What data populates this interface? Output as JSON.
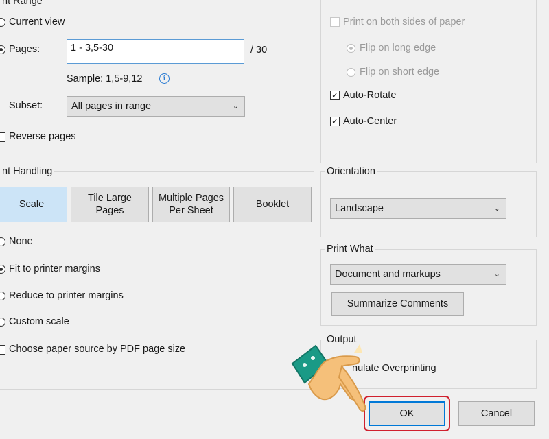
{
  "page_range": {
    "legend": "nt Range",
    "current_view": "Current view",
    "pages_label": "Pages:",
    "pages_value": "1 - 3,5-30",
    "pages_total": "/ 30",
    "sample": "Sample: 1,5-9,12",
    "subset_label": "Subset:",
    "subset_value": "All pages in range",
    "reverse_pages": "Reverse pages"
  },
  "duplex": {
    "both_sides": "Print on both sides of paper",
    "flip_long": "Flip on long edge",
    "flip_short": "Flip on short edge",
    "auto_rotate": "Auto-Rotate",
    "auto_center": "Auto-Center"
  },
  "page_handling": {
    "legend": "nt Handling",
    "tabs": {
      "scale": "Scale",
      "tile_line1": "Tile Large",
      "tile_line2": "Pages",
      "multiple_line1": "Multiple Pages",
      "multiple_line2": "Per Sheet",
      "booklet": "Booklet"
    },
    "none": "None",
    "fit": "Fit to printer margins",
    "reduce": "Reduce to printer margins",
    "custom": "Custom scale",
    "paper_source": "Choose paper source by PDF page size"
  },
  "orientation": {
    "legend": "Orientation",
    "value": "Landscape"
  },
  "print_what": {
    "legend": "Print What",
    "value": "Document and markups",
    "summarize": "Summarize Comments"
  },
  "output": {
    "legend": "Output",
    "simulate": "Simulate Overprinting",
    "simulate_visible": "nulate Overprinting"
  },
  "footer": {
    "ok": "OK",
    "cancel": "Cancel"
  },
  "colors": {
    "highlight": "#d0202e",
    "hand_cuff": "#1a9a86",
    "hand_skin": "#f5c07a"
  }
}
